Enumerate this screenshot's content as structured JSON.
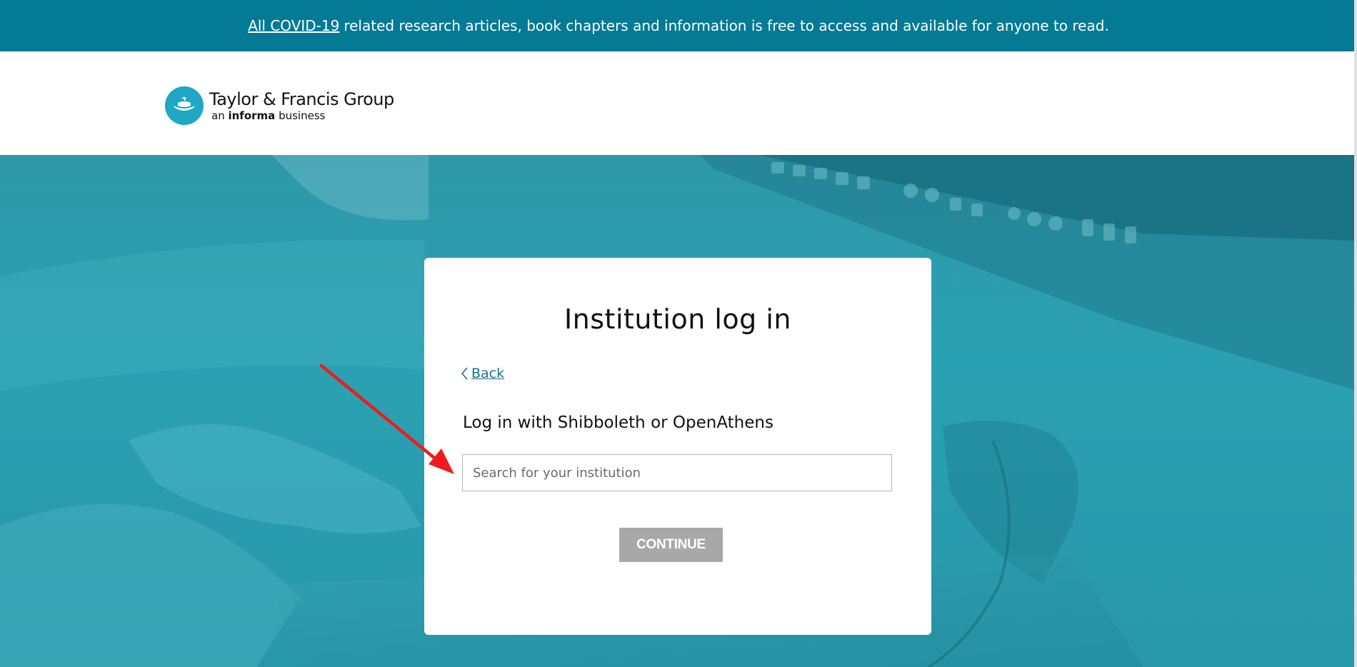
{
  "banner": {
    "link_text": "All COVID-19",
    "text": "related research articles, book chapters and information is free to access and available for anyone to read.",
    "background": "#047a94"
  },
  "header": {
    "logo_title": "Taylor & Francis Group",
    "logo_sub_prefix": "an",
    "logo_sub_bold": "informa",
    "logo_sub_suffix": "business",
    "logo_icon": "teapot-lamp-icon"
  },
  "login_card": {
    "title": "Institution log in",
    "back_label": "Back",
    "subtitle": "Log in with Shibboleth or OpenAthens",
    "search_placeholder": "Search for your institution",
    "search_value": "",
    "continue_label": "CONTINUE"
  },
  "colors": {
    "accent": "#1a7189",
    "hero_tint": "#2aa1b2",
    "button_disabled": "#a8a8a8",
    "annotation_arrow": "#ee1c1c"
  }
}
